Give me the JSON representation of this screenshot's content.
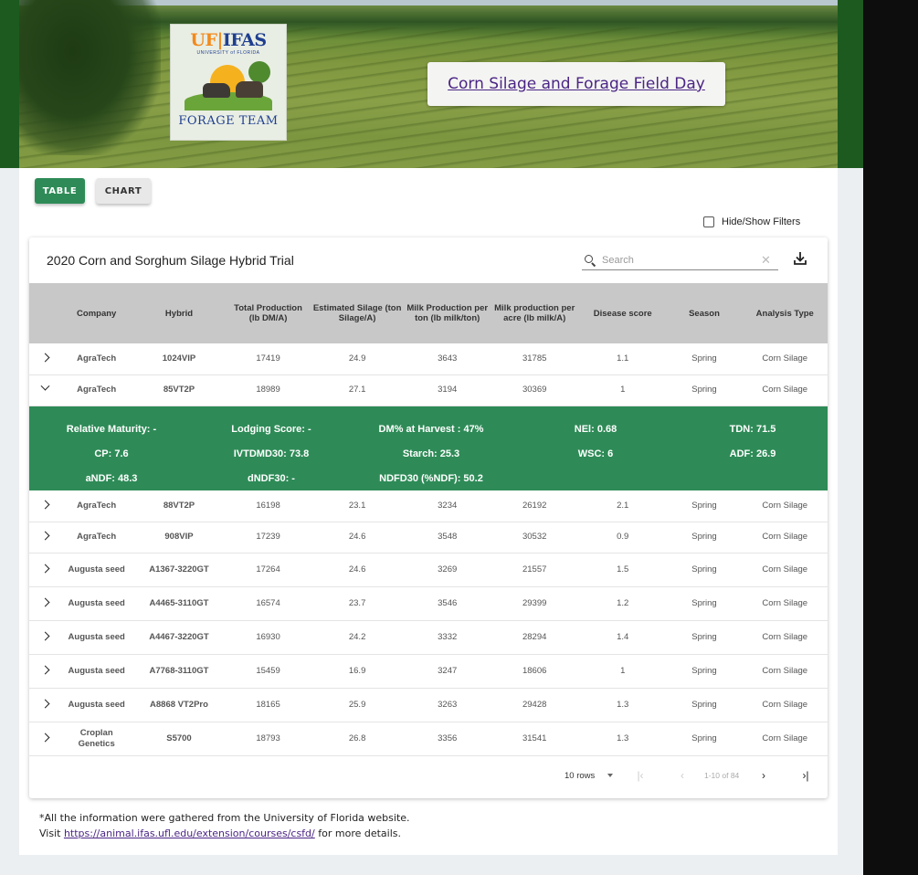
{
  "banner": {
    "title": "Corn Silage and Forage Field Day",
    "logo": {
      "org": "UF|IFAS",
      "university": "UNIVERSITY of FLORIDA",
      "team": "FORAGE TEAM"
    }
  },
  "toolbar": {
    "table_label": "TABLE",
    "chart_label": "CHART",
    "filters_label": "Hide/Show Filters"
  },
  "card": {
    "title": "2020 Corn and Sorghum Silage Hybrid Trial",
    "search_placeholder": "Search",
    "download_icon": "download-icon"
  },
  "table": {
    "columns": [
      "Company",
      "Hybrid",
      "Total Production (lb DM/A)",
      "Estimated Silage (ton Silage/A)",
      "Milk Production per ton (lb milk/ton)",
      "Milk production per acre (lb milk/A)",
      "Disease score",
      "Season",
      "Analysis Type"
    ],
    "rows": [
      [
        "AgraTech",
        "1024VIP",
        "17419",
        "24.9",
        "3643",
        "31785",
        "1.1",
        "Spring",
        "Corn Silage"
      ],
      [
        "AgraTech",
        "85VT2P",
        "18989",
        "27.1",
        "3194",
        "30369",
        "1",
        "Spring",
        "Corn Silage"
      ],
      [
        "AgraTech",
        "88VT2P",
        "16198",
        "23.1",
        "3234",
        "26192",
        "2.1",
        "Spring",
        "Corn Silage"
      ],
      [
        "AgraTech",
        "908VIP",
        "17239",
        "24.6",
        "3548",
        "30532",
        "0.9",
        "Spring",
        "Corn Silage"
      ],
      [
        "Augusta seed",
        "A1367-3220GT",
        "17264",
        "24.6",
        "3269",
        "21557",
        "1.5",
        "Spring",
        "Corn Silage"
      ],
      [
        "Augusta seed",
        "A4465-3110GT",
        "16574",
        "23.7",
        "3546",
        "29399",
        "1.2",
        "Spring",
        "Corn Silage"
      ],
      [
        "Augusta seed",
        "A4467-3220GT",
        "16930",
        "24.2",
        "3332",
        "28294",
        "1.4",
        "Spring",
        "Corn Silage"
      ],
      [
        "Augusta seed",
        "A7768-3110GT",
        "15459",
        "16.9",
        "3247",
        "18606",
        "1",
        "Spring",
        "Corn Silage"
      ],
      [
        "Augusta seed",
        "A8868 VT2Pro",
        "18165",
        "25.9",
        "3263",
        "29428",
        "1.3",
        "Spring",
        "Corn Silage"
      ],
      [
        "Croplan Genetics",
        "S5700",
        "18793",
        "26.8",
        "3356",
        "31541",
        "1.3",
        "Spring",
        "Corn Silage"
      ]
    ],
    "detail": [
      "Relative Maturity: -",
      "Lodging Score: -",
      "DM% at Harvest : 47%",
      "NEl: 0.68",
      "TDN: 71.5",
      "CP: 7.6",
      "IVTDMD30: 73.8",
      "Starch: 25.3",
      "WSC: 6",
      "ADF: 26.9",
      "aNDF: 48.3",
      "dNDF30: -",
      "NDFD30 (%NDF): 50.2",
      "",
      ""
    ]
  },
  "pager": {
    "rows_label": "10 rows",
    "info": "1-10 of 84"
  },
  "footer": {
    "line1": "*All the information were gathered from the University of Florida website.",
    "visit": "Visit ",
    "link": "https://animal.ifas.ufl.edu/extension/courses/csfd/",
    "tail": " for more details."
  },
  "colors": {
    "accent": "#2e8b57",
    "link": "#4b2585",
    "header_bg": "#c8c8c8"
  }
}
